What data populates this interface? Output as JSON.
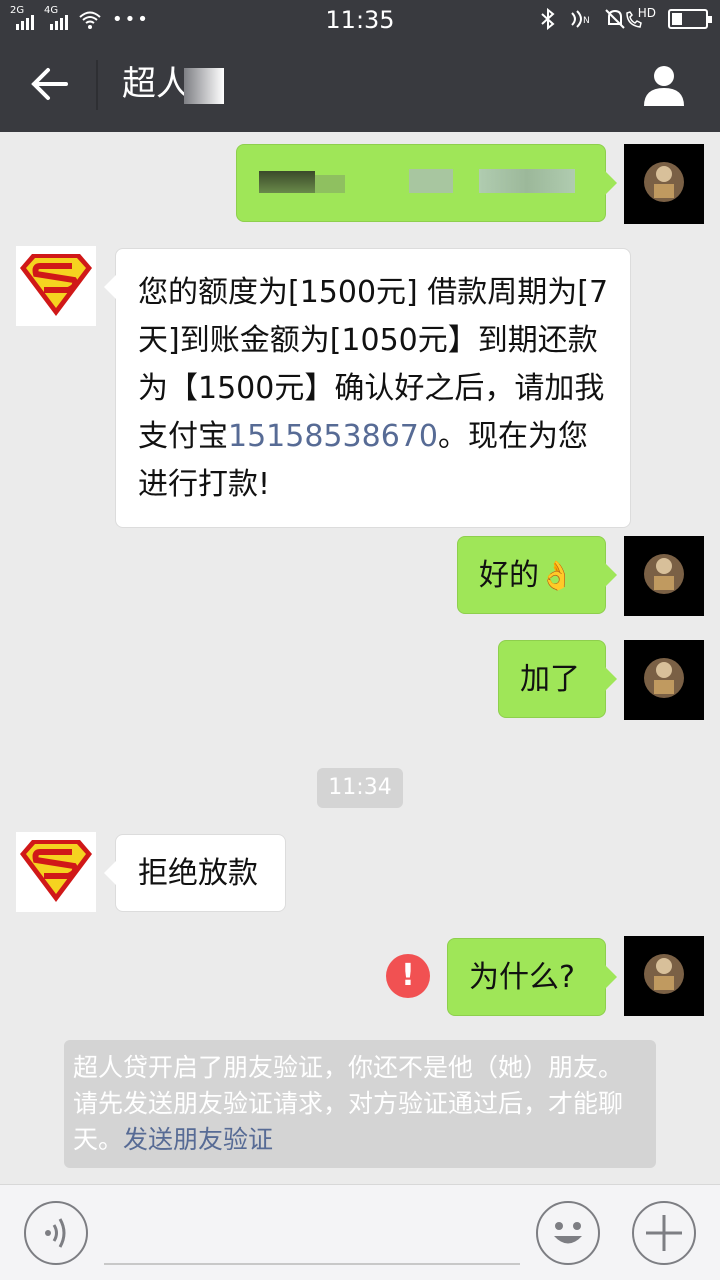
{
  "status_bar": {
    "time": "11:35",
    "network_1": "2G",
    "network_2": "4G",
    "more": "•••",
    "hd": "HD",
    "battery_level": 0.3
  },
  "header": {
    "title": "超人贷",
    "title_visible": "超人"
  },
  "messages": [
    {
      "sender": "me",
      "text": ""
    },
    {
      "sender": "other",
      "text_parts": [
        "您的额度为[1500元] 借款周期为[7天]到账金额为[1050元】到期还款为【1500元】确认好之后，请加我支付宝",
        "15158538670",
        "。现在为您进行打款!"
      ]
    },
    {
      "sender": "me",
      "text": "好的",
      "emoji": "👌"
    },
    {
      "sender": "me",
      "text": "加了"
    },
    {
      "sender": "other",
      "text": "拒绝放款"
    },
    {
      "sender": "me",
      "text": "为什么?",
      "failed": true
    }
  ],
  "timestamp": "11:34",
  "error_mark": "!",
  "system_notice": {
    "text": "超人贷开启了朋友验证，你还不是他（她）朋友。请先发送朋友验证请求，对方验证通过后，才能聊天。",
    "link": "发送朋友验证"
  },
  "icons": {
    "back": "back-arrow-icon",
    "profile": "person-icon",
    "voice": "voice-icon",
    "emoji": "smiley-icon",
    "plus": "plus-icon",
    "superman": "superman-logo-icon"
  },
  "colors": {
    "header_bg": "#393a3f",
    "chat_bg": "#ebebeb",
    "my_bubble": "#9fe658",
    "other_bubble": "#ffffff",
    "link": "#576b95",
    "error": "#f15152"
  }
}
